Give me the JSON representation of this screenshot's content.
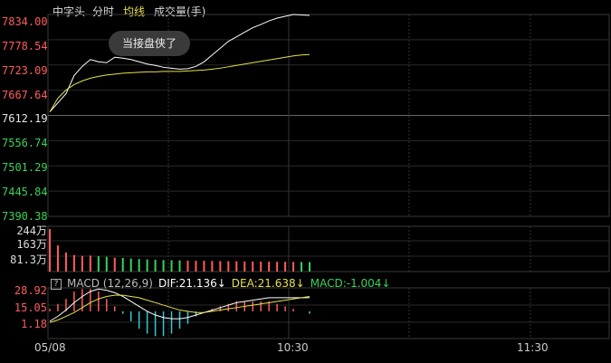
{
  "tabs": [
    {
      "label": "中字头",
      "active": false
    },
    {
      "label": "分时",
      "active": false
    },
    {
      "label": "均线",
      "active": true
    },
    {
      "label": "成交量(手)",
      "active": false
    }
  ],
  "price_axis": [
    "7834.00",
    "7778.54",
    "7723.09",
    "7667.64",
    "7612.19",
    "7556.74",
    "7501.29",
    "7445.84",
    "7390.38"
  ],
  "volume_axis": [
    "244万",
    "163万",
    "81.3万"
  ],
  "macd_axis": [
    "28.92",
    "15.05",
    "1.18"
  ],
  "toast": "当接盘侠了",
  "macd": {
    "name": "MACD (12,26,9)",
    "dif": "DIF:21.136",
    "dea": "DEA:21.638",
    "macd": "MACD:-1.004",
    "help": "?"
  },
  "time_axis": [
    "05/08",
    "10:30",
    "11:30"
  ],
  "colors": {
    "up": "#ff5c5c",
    "down": "#39d35a",
    "avg": "#e8e04a",
    "price": "#ffffff",
    "macd_neg": "#35c8d8"
  },
  "chart_data": {
    "type": "line",
    "price_series": [
      7620,
      7640,
      7660,
      7700,
      7720,
      7735,
      7730,
      7728,
      7740,
      7738,
      7735,
      7730,
      7725,
      7722,
      7718,
      7716,
      7714,
      7715,
      7720,
      7730,
      7745,
      7760,
      7775,
      7785,
      7795,
      7805,
      7812,
      7820,
      7826,
      7830,
      7834,
      7833,
      7832
    ],
    "avg_series": [
      7620,
      7650,
      7668,
      7680,
      7688,
      7694,
      7698,
      7701,
      7703,
      7705,
      7706,
      7707,
      7708,
      7708,
      7709,
      7709,
      7709,
      7710,
      7711,
      7712,
      7714,
      7716,
      7719,
      7722,
      7725,
      7728,
      7731,
      7734,
      7737,
      7740,
      7743,
      7745,
      7746
    ],
    "volume": [
      244,
      150,
      110,
      95,
      90,
      92,
      88,
      85,
      80,
      78,
      75,
      72,
      70,
      68,
      66,
      65,
      64,
      63,
      62,
      62,
      61,
      60,
      60,
      59,
      58,
      58,
      57,
      57,
      56,
      56,
      55,
      55,
      54
    ],
    "dif": [
      2,
      6,
      11,
      17,
      22,
      26,
      28,
      27,
      25,
      22,
      18,
      14,
      10,
      7,
      5,
      4,
      4,
      5,
      7,
      9,
      11,
      13,
      15,
      17,
      18,
      19,
      20,
      21,
      21,
      21,
      21,
      21,
      21
    ],
    "dea": [
      1,
      3,
      6,
      9,
      13,
      17,
      20,
      22,
      23,
      23,
      22,
      21,
      19,
      17,
      15,
      13,
      11,
      10,
      9,
      9,
      10,
      11,
      12,
      13,
      14,
      15,
      16,
      17,
      18,
      19,
      20,
      21,
      22
    ],
    "ylim_price": [
      7390.38,
      7834.0
    ]
  }
}
